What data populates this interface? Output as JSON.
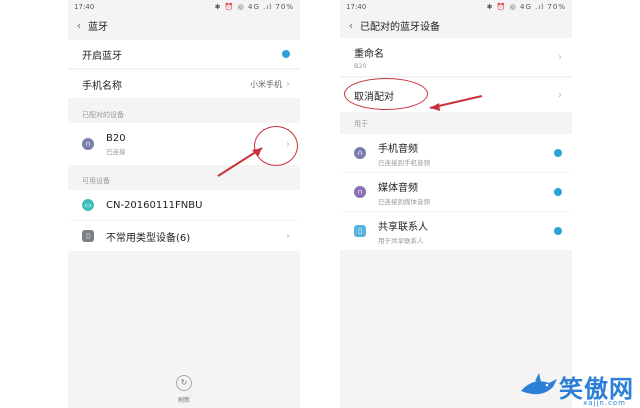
{
  "left": {
    "status": {
      "time": "17:40",
      "icons": "✱ ⏰ ◎ 4G .ıl 70%"
    },
    "title": "蓝牙",
    "bluetooth_toggle_label": "开启蓝牙",
    "device_name_label": "手机名称",
    "device_name_value": "小米手机",
    "paired_header": "已配对的设备",
    "paired_device": {
      "name": "B20",
      "status": "已连接"
    },
    "available_header": "可用设备",
    "available_devices": [
      {
        "name": "CN-20160111FNBU"
      },
      {
        "name": "不常用类型设备(6)"
      }
    ],
    "refresh_label": "刷新"
  },
  "right": {
    "status": {
      "time": "17:40",
      "icons": "✱ ⏰ ◎ 4G .ıl 70%"
    },
    "title": "已配对的蓝牙设备",
    "rename_label": "重命名",
    "rename_value": "B20",
    "unpair_label": "取消配对",
    "use_for_header": "用于",
    "profiles": [
      {
        "name": "手机音频",
        "desc": "已连接到手机音频"
      },
      {
        "name": "媒体音频",
        "desc": "已连接到媒体音频"
      },
      {
        "name": "共享联系人",
        "desc": "用于共享联系人"
      }
    ]
  },
  "watermark": {
    "brand": "笑傲网",
    "url": "xajjn.com"
  },
  "colors": {
    "accent": "#2aa4d8",
    "annotation": "#c8323a",
    "watermark": "#2b7fd6"
  }
}
